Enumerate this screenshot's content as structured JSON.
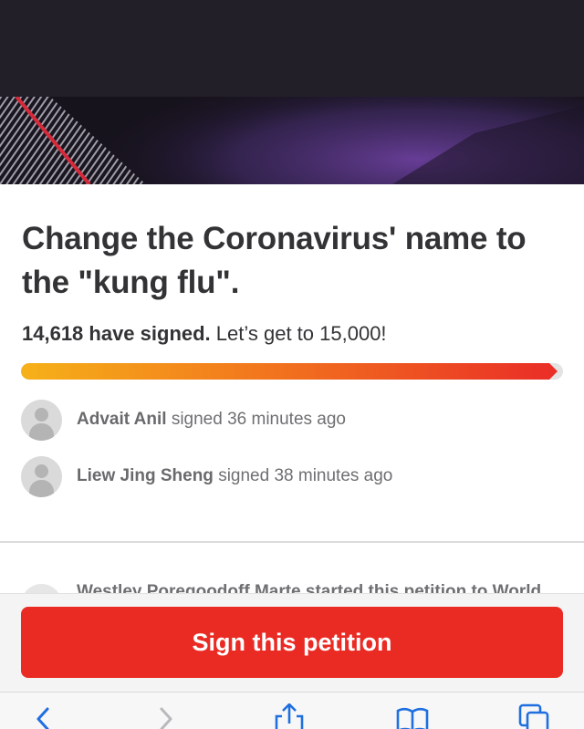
{
  "petition": {
    "title": "Change the Coronavirus' name to the \"kung flu\".",
    "signed_count": "14,618 have signed.",
    "goal_text": "Let’s get to 15,000!",
    "progress_fraction": 0.975,
    "progress_colors": [
      "#f6b119",
      "#f2771d",
      "#ea2f27"
    ]
  },
  "recent_signers": [
    {
      "name": "Advait Anil",
      "action": "signed 36 minutes ago"
    },
    {
      "name": "Liew Jing Sheng",
      "action": "signed 38 minutes ago"
    }
  ],
  "starter_text": "Westley Poregoodoff Marte started this petition to World",
  "cta": {
    "label": "Sign this petition",
    "color": "#ea2b24"
  },
  "toolbar": {
    "icons": [
      "back-icon",
      "forward-icon",
      "share-icon",
      "bookmarks-icon",
      "tabs-icon"
    ]
  }
}
